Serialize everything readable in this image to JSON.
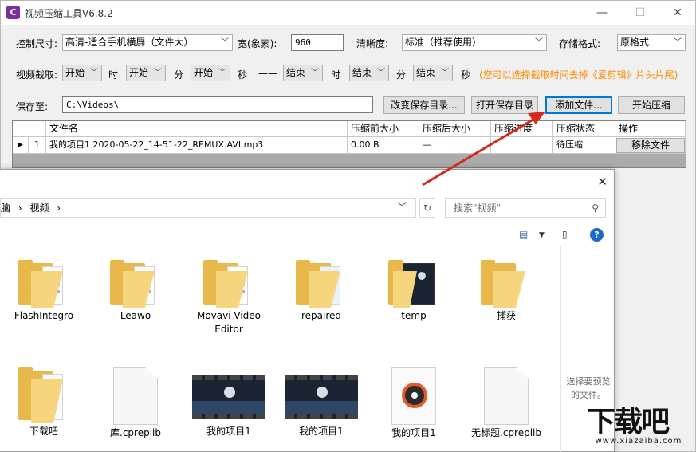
{
  "window": {
    "title": "视频压缩工具V6.8.2",
    "app_icon_text": "C",
    "minimize": "—",
    "maximize": "☐",
    "close": "✕"
  },
  "settings": {
    "size_label": "控制尺寸:",
    "size_value": "高清-适合手机横屏（文件大）",
    "width_label": "宽(象素):",
    "width_value": "960",
    "clarity_label": "清晰度:",
    "clarity_value": "标准（推荐使用）",
    "format_label": "存储格式:",
    "format_value": "原格式"
  },
  "trim": {
    "label": "视频截取:",
    "start_h": "开始",
    "h_label": "时",
    "start_m": "开始",
    "m_label": "分",
    "start_s": "开始",
    "s_label": "秒",
    "dash": "——",
    "end_h": "结束",
    "h_label2": "时",
    "end_m": "结束",
    "m_label2": "分",
    "end_s": "结束",
    "s_label2": "秒",
    "hint": "(您可以选择截取时间去掉《爱剪辑》片头片尾)"
  },
  "save": {
    "label": "保存至:",
    "path": "C:\\Videos\\",
    "change_dir": "改变保存目录...",
    "open_dir": "打开保存目录",
    "add_file": "添加文件...",
    "start": "开始压缩"
  },
  "grid": {
    "headers": [
      "文件名",
      "压缩前大小",
      "压缩后大小",
      "压缩进度",
      "压缩状态",
      "操作"
    ],
    "rows": [
      {
        "marker": "▶",
        "index": "1",
        "name": "我的项目1 2020-05-22_14-51-22_REMUX.AVI.mp3",
        "before": "0.00 B",
        "after": "—",
        "progress": "",
        "status": "待压缩",
        "action": "移除文件"
      }
    ]
  },
  "dialog": {
    "close": "✕",
    "breadcrumb": [
      "脑",
      "›",
      "视频",
      "›"
    ],
    "refresh": "↻",
    "search_placeholder": "搜索\"视频\"",
    "help": "?",
    "preview_text": "选择要预览的文件。",
    "items_row1": [
      {
        "label": "FlashIntegro",
        "type": "folder"
      },
      {
        "label": "Leawo",
        "type": "folder"
      },
      {
        "label": "Movavi Video Editor",
        "type": "folder"
      },
      {
        "label": "repaired",
        "type": "folder-ie"
      },
      {
        "label": "temp",
        "type": "folder-video"
      },
      {
        "label": "捕获",
        "type": "folder-empty"
      }
    ],
    "items_row2": [
      {
        "label": "下载吧",
        "type": "folder-doc"
      },
      {
        "label": "库.cpreplib",
        "type": "doc"
      },
      {
        "label": "我的项目1",
        "type": "video"
      },
      {
        "label": "我的项目1",
        "type": "video"
      },
      {
        "label": "我的项目1",
        "type": "music"
      },
      {
        "label": "无标题.cpreplib",
        "type": "doc"
      }
    ]
  },
  "watermark": {
    "big": "下载吧",
    "small": "www.xiazaiba.com"
  },
  "colors": {
    "accent": "#0078d7",
    "hint": "#ff8c00",
    "arrow": "#d42a1e"
  }
}
